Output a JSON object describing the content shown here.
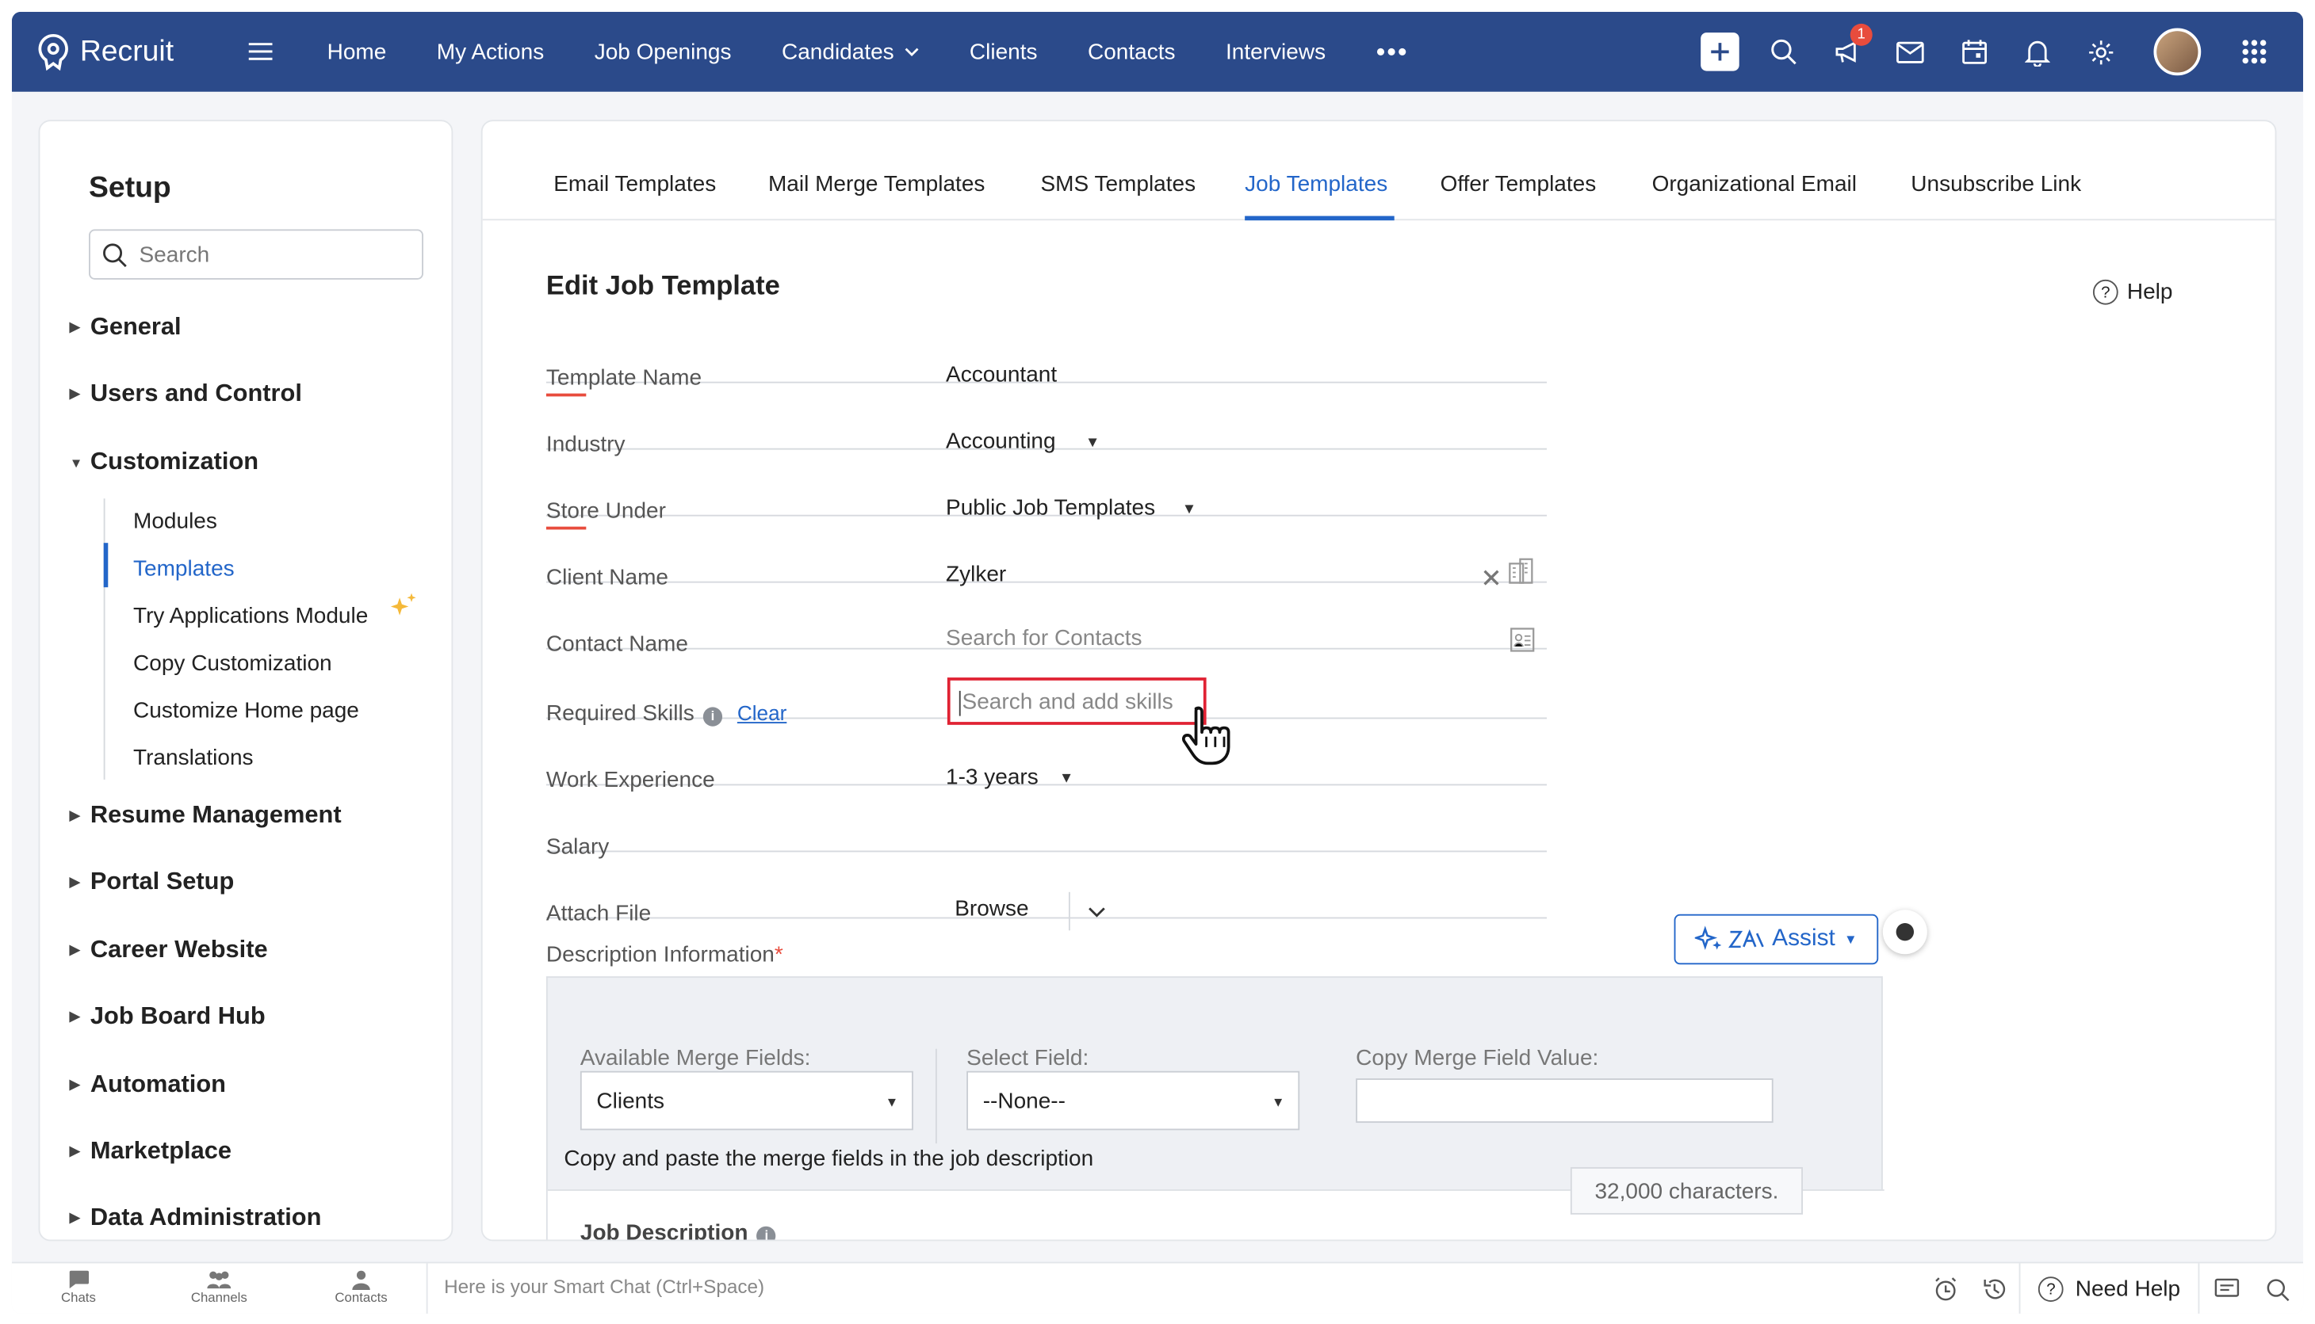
{
  "app": {
    "name": "Recruit"
  },
  "nav": {
    "items": [
      "Home",
      "My Actions",
      "Job Openings",
      "Candidates",
      "Clients",
      "Contacts",
      "Interviews"
    ],
    "more": "•••",
    "notification_count": "1"
  },
  "colors": {
    "topbar": "#2b4a8a",
    "accent": "#2366c9",
    "required": "#e84c3d",
    "highlight": "#e02233"
  },
  "sidebar": {
    "title": "Setup",
    "search_placeholder": "Search",
    "sections": [
      "General",
      "Users and Control",
      "Customization",
      "Resume Management",
      "Portal Setup",
      "Career Website",
      "Job Board Hub",
      "Automation",
      "Marketplace",
      "Data Administration"
    ],
    "customization_items": [
      "Modules",
      "Templates",
      "Try Applications Module",
      "Copy Customization",
      "Customize Home page",
      "Translations"
    ],
    "active_item": "Templates"
  },
  "tabs": [
    "Email Templates",
    "Mail Merge Templates",
    "SMS Templates",
    "Job Templates",
    "Offer Templates",
    "Organizational Email",
    "Unsubscribe Link"
  ],
  "active_tab": "Job Templates",
  "form": {
    "title": "Edit Job Template",
    "help": "Help",
    "template_name": {
      "label": "Template Name",
      "value": "Accountant"
    },
    "industry": {
      "label": "Industry",
      "value": "Accounting"
    },
    "store_under": {
      "label": "Store Under",
      "value": "Public Job Templates"
    },
    "client_name": {
      "label": "Client Name",
      "value": "Zylker"
    },
    "contact_name": {
      "label": "Contact Name",
      "placeholder": "Search for Contacts"
    },
    "required_skills": {
      "label": "Required Skills",
      "clear": "Clear",
      "placeholder": "Search and add skills"
    },
    "work_experience": {
      "label": "Work Experience",
      "value": "1-3 years"
    },
    "salary": {
      "label": "Salary"
    },
    "attach_file": {
      "label": "Attach File",
      "browse": "Browse"
    }
  },
  "description": {
    "label": "Description Information",
    "required_mark": "*",
    "assist": "Assist",
    "available_merge_fields": {
      "label": "Available Merge Fields:",
      "value": "Clients"
    },
    "select_field": {
      "label": "Select Field:",
      "value": "--None--"
    },
    "copy_merge_field_value": {
      "label": "Copy Merge Field Value:"
    },
    "note": "Copy and paste the merge fields in the job description",
    "char_limit": "32,000 characters.",
    "job_description": "Job Description"
  },
  "bottom": {
    "items": [
      "Chats",
      "Channels",
      "Contacts"
    ],
    "smart_chat_placeholder": "Here is your Smart Chat (Ctrl+Space)",
    "need_help": "Need Help"
  }
}
